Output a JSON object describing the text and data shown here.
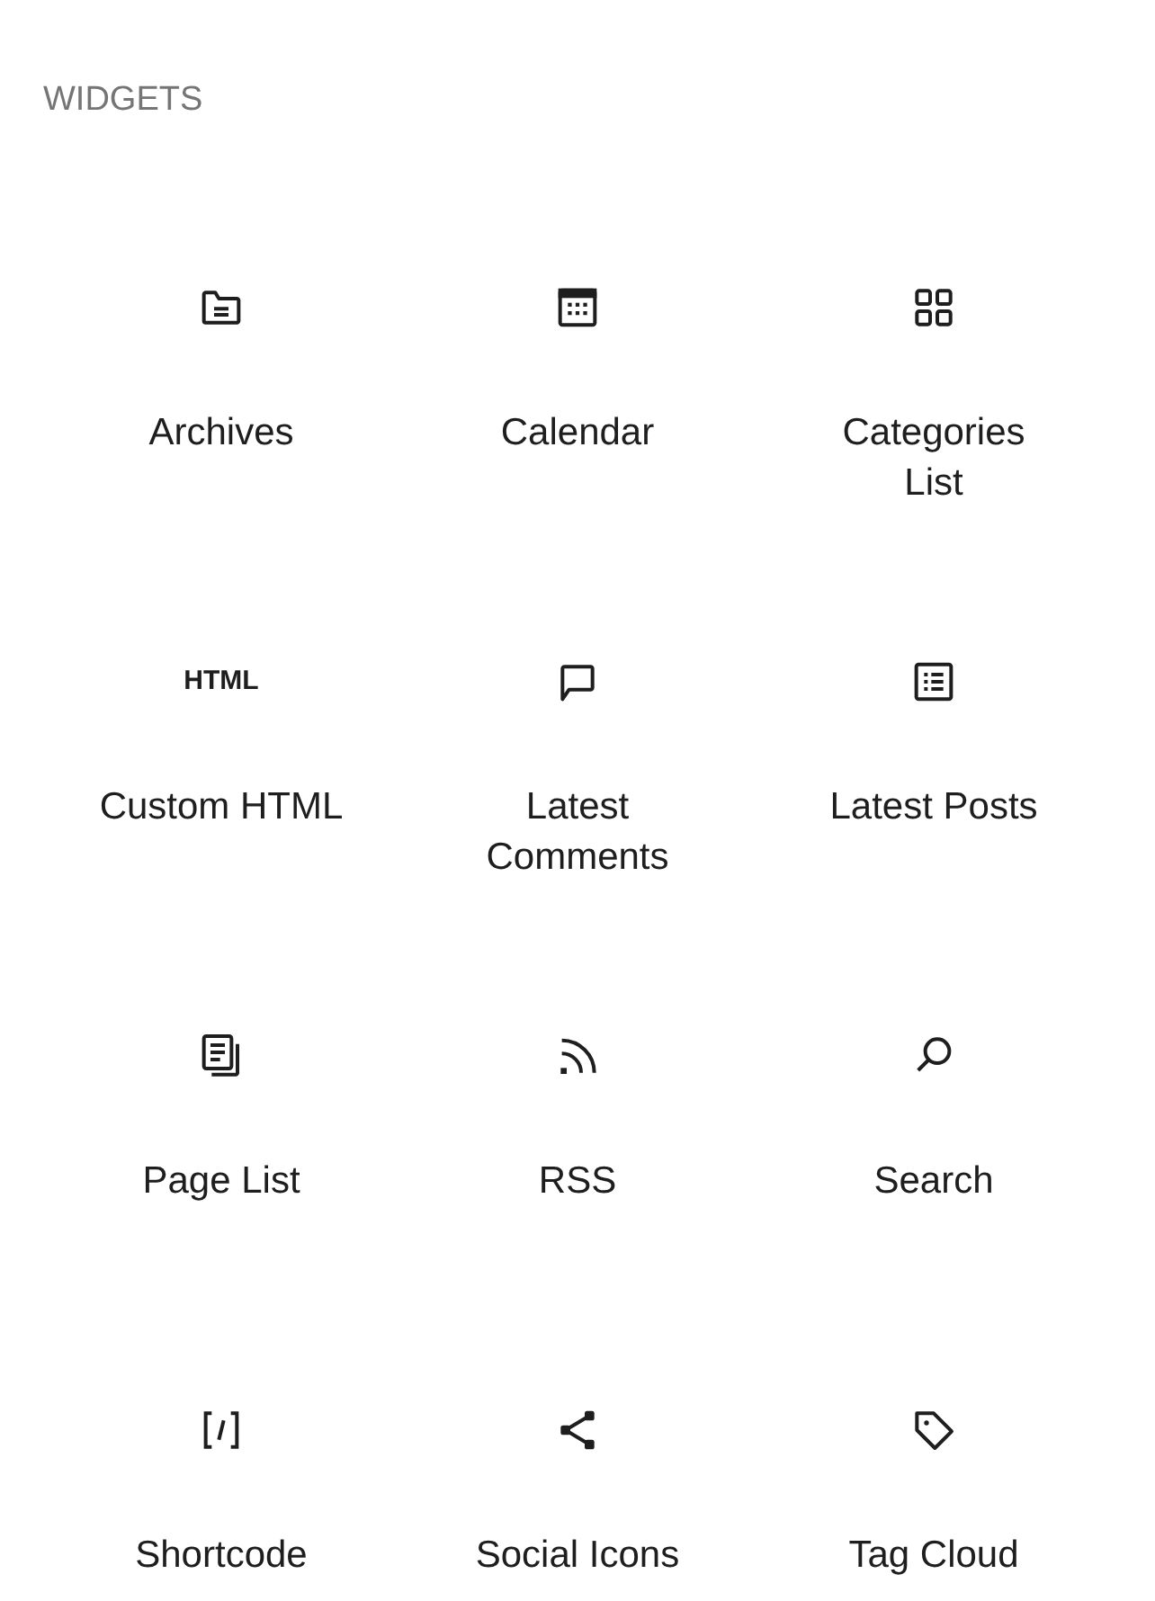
{
  "heading": "WIDGETS",
  "items": [
    {
      "kind": "archive",
      "lines": [
        "Archives"
      ]
    },
    {
      "kind": "calendar",
      "lines": [
        "Calendar"
      ]
    },
    {
      "kind": "grid",
      "lines": [
        "Categories",
        "List"
      ]
    },
    {
      "kind": "text",
      "icon_text": "HTML",
      "lines": [
        "Custom HTML"
      ]
    },
    {
      "kind": "comment",
      "lines": [
        "Latest",
        "Comments"
      ]
    },
    {
      "kind": "list",
      "lines": [
        "Latest Posts"
      ]
    },
    {
      "kind": "pages",
      "lines": [
        "Page List"
      ]
    },
    {
      "kind": "rss",
      "lines": [
        "RSS"
      ]
    },
    {
      "kind": "search",
      "lines": [
        "Search"
      ]
    },
    {
      "kind": "shortcode",
      "lines": [
        "Shortcode"
      ]
    },
    {
      "kind": "share",
      "lines": [
        "Social Icons"
      ]
    },
    {
      "kind": "tag",
      "lines": [
        "Tag Cloud"
      ]
    }
  ]
}
